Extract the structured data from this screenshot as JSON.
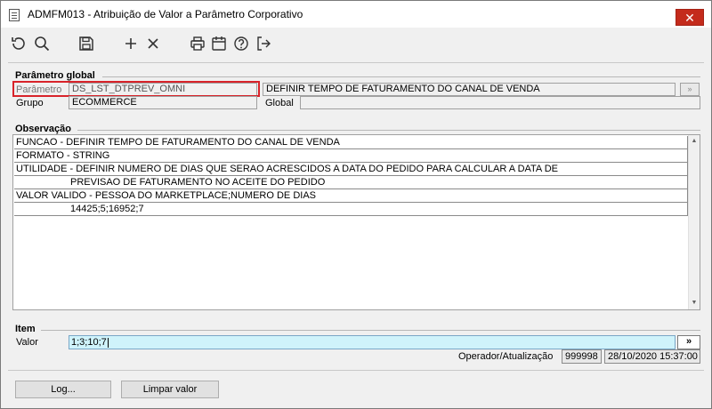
{
  "window": {
    "title": "ADMFM013 - Atribuição de Valor a Parâmetro Corporativo",
    "close_glyph": "✕"
  },
  "toolbar": {
    "icons": [
      "refresh-icon",
      "search-icon",
      "save-icon",
      "add-icon",
      "delete-icon",
      "print-icon",
      "calendar-icon",
      "help-icon",
      "exit-icon"
    ]
  },
  "parametro_global": {
    "group_label": "Parâmetro global",
    "parametro_label": "Parâmetro",
    "parametro_value": "DS_LST_DTPREV_OMNI",
    "descricao_value": "DEFINIR TEMPO DE FATURAMENTO DO CANAL DE VENDA",
    "grupo_label": "Grupo",
    "grupo_value": "ECOMMERCE",
    "global_label": "Global",
    "global_value": "",
    "lookup_button": "»"
  },
  "observacao": {
    "group_label": "Observação",
    "lines": [
      "FUNCAO - DEFINIR TEMPO DE FATURAMENTO DO CANAL DE VENDA",
      "FORMATO - STRING",
      "UTILIDADE - DEFINIR NUMERO DE DIAS QUE SERAO ACRESCIDOS A DATA DO PEDIDO PARA CALCULAR A DATA DE",
      "PREVISAO DE FATURAMENTO NO ACEITE DO PEDIDO",
      "VALOR VALIDO - PESSOA DO MARKETPLACE;NUMERO DE DIAS",
      "14425;5;16952;7"
    ],
    "scroll_up": "▲",
    "scroll_down": "▼"
  },
  "item": {
    "group_label": "Item",
    "valor_label": "Valor",
    "valor_value": "1;3;10;7",
    "more_button": "»",
    "operador_label": "Operador/Atualização",
    "operador_value": "999998",
    "atualizacao_value": "28/10/2020 15:37:00"
  },
  "footer": {
    "log_button": "Log...",
    "limpar_button": "Limpar valor"
  },
  "colors": {
    "highlight_border": "#d8232a",
    "input_active_bg": "#cff3fb",
    "close_button_bg": "#c42b1c"
  }
}
